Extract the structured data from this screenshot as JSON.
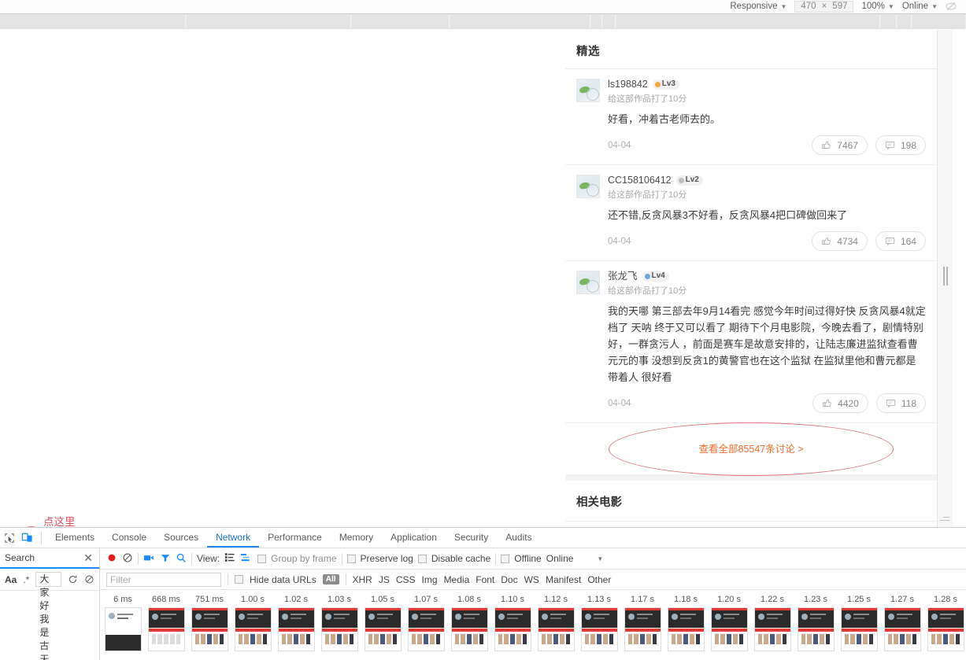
{
  "device_bar": {
    "device_label": "Responsive",
    "width": "470",
    "times": "×",
    "height": "597",
    "zoom": "100%",
    "throttle": "Online",
    "caret": "▼"
  },
  "viewport": {
    "featured_title": "精选",
    "comments": [
      {
        "name": "ls198842",
        "level": "Lv3",
        "level_color": "#f2a93b",
        "rating_text": "给这部作品打了10分",
        "body": "好看，冲着古老师去的。",
        "date": "04-04",
        "likes": "7467",
        "replies": "198"
      },
      {
        "name": "CC158106412",
        "level": "Lv2",
        "level_color": "#bdbdbd",
        "rating_text": "给这部作品打了10分",
        "body": "还不错,反贪风暴3不好看，反贪风暴4把口碑做回来了",
        "date": "04-04",
        "likes": "4734",
        "replies": "164"
      },
      {
        "name": "张龙飞",
        "level": "Lv4",
        "level_color": "#6fa8dc",
        "rating_text": "给这部作品打了10分",
        "body": "我的天哪 第三部去年9月14看完 感觉今年时间过得好快 反贪风暴4就定档了 天呐 终于又可以看了 期待下个月电影院，今晚去看了，剧情特别好，一群贪污人 ，前面是赛车是故意安排的，让陆志廉进监狱查看曹元元的事 没想到反贪1的黄警官也在这个监狱 在监狱里他和曹元都是带着人 很好看",
        "date": "04-04",
        "likes": "4420",
        "replies": "118"
      }
    ],
    "view_all": "查看全部85547条讨论 >",
    "view_all_color": "#ef6d2e",
    "related_title": "相关电影",
    "related_posters": [
      {
        "name": "poster-1",
        "c1": "#2c4556",
        "c2": "#7ba3bd"
      },
      {
        "name": "poster-2",
        "c1": "#16243f",
        "c2": "#3f6fae"
      },
      {
        "name": "poster-3",
        "c1": "#0d0d0d",
        "c2": "#6b5d4f"
      },
      {
        "name": "poster-4",
        "c1": "#8c1410",
        "c2": "#d6443a"
      },
      {
        "name": "poster-5",
        "c1": "#11161c",
        "c2": "#54606c"
      },
      {
        "name": "poster-6",
        "c1": "#0a0a0a",
        "c2": "#7f7f7f"
      },
      {
        "name": "poster-7",
        "c1": "#b00030",
        "c2": "#e2003c"
      }
    ]
  },
  "annotation": {
    "text": "点这里",
    "color": "#e2565f"
  },
  "devtools": {
    "tabs": [
      {
        "label": "Elements",
        "active": false
      },
      {
        "label": "Console",
        "active": false
      },
      {
        "label": "Sources",
        "active": false
      },
      {
        "label": "Network",
        "active": true
      },
      {
        "label": "Performance",
        "active": false
      },
      {
        "label": "Memory",
        "active": false
      },
      {
        "label": "Application",
        "active": false
      },
      {
        "label": "Security",
        "active": false
      },
      {
        "label": "Audits",
        "active": false
      }
    ],
    "search_panel": {
      "title": "Search",
      "close": "✕",
      "match_case_label": "Aa",
      "regex_label": ".*",
      "query_value": "大家好我是古天乐"
    },
    "network": {
      "view_label": "View:",
      "group_by_frame": "Group by frame",
      "preserve_log": "Preserve log",
      "disable_cache": "Disable cache",
      "offline": "Offline",
      "throttle_value": "Online",
      "filter_placeholder": "Filter",
      "hide_data_urls": "Hide data URLs",
      "types": [
        "All",
        "XHR",
        "JS",
        "CSS",
        "Img",
        "Media",
        "Font",
        "Doc",
        "WS",
        "Manifest",
        "Other"
      ]
    },
    "filmstrip": [
      {
        "time": "6 ms",
        "kind": "first"
      },
      {
        "time": "668 ms",
        "kind": "second"
      },
      {
        "time": "751 ms",
        "kind": "full"
      },
      {
        "time": "1.00 s",
        "kind": "full"
      },
      {
        "time": "1.02 s",
        "kind": "full"
      },
      {
        "time": "1.03 s",
        "kind": "full"
      },
      {
        "time": "1.05 s",
        "kind": "full"
      },
      {
        "time": "1.07 s",
        "kind": "full"
      },
      {
        "time": "1.08 s",
        "kind": "full"
      },
      {
        "time": "1.10 s",
        "kind": "full"
      },
      {
        "time": "1.12 s",
        "kind": "full"
      },
      {
        "time": "1.13 s",
        "kind": "full"
      },
      {
        "time": "1.17 s",
        "kind": "full"
      },
      {
        "time": "1.18 s",
        "kind": "full"
      },
      {
        "time": "1.20 s",
        "kind": "full"
      },
      {
        "time": "1.22 s",
        "kind": "full"
      },
      {
        "time": "1.23 s",
        "kind": "full"
      },
      {
        "time": "1.25 s",
        "kind": "full"
      },
      {
        "time": "1.27 s",
        "kind": "full"
      },
      {
        "time": "1.28 s",
        "kind": "full"
      }
    ]
  }
}
